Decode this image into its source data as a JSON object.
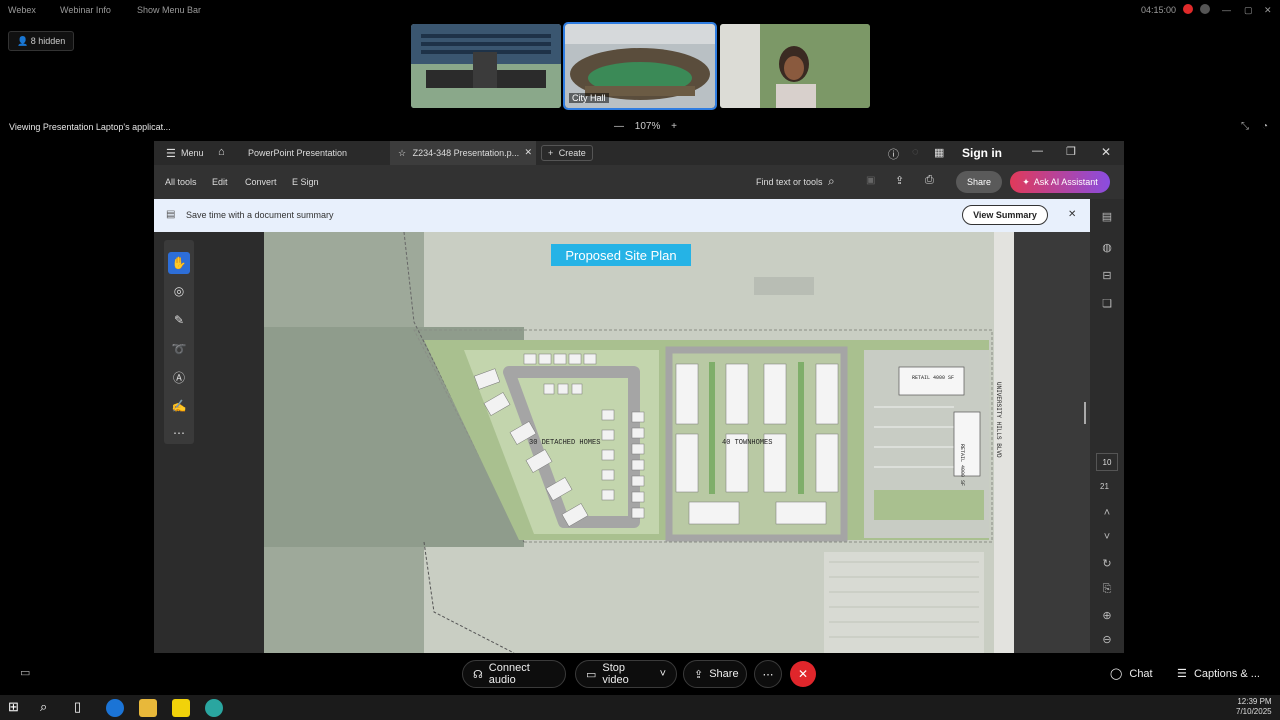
{
  "webex": {
    "app_name": "Webex",
    "webinar_info": "Webinar Info",
    "show_menu_bar": "Show Menu Bar",
    "clock": "04:15:00",
    "hidden_count": "8 hidden",
    "thumbnails": [
      {
        "label": ""
      },
      {
        "label": "City Hall"
      },
      {
        "label": ""
      }
    ],
    "viewing_text": "Viewing Presentation Laptop's applicat...",
    "zoom_level": "107%",
    "controls": {
      "connect_audio": "Connect audio",
      "stop_video": "Stop video",
      "share": "Share",
      "chat": "Chat",
      "captions": "Captions & ..."
    }
  },
  "acrobat": {
    "menu": "Menu",
    "tabs": [
      {
        "label": "PowerPoint Presentation"
      },
      {
        "label": "Z234-348 Presentation.p..."
      },
      {
        "label": "Create"
      }
    ],
    "sign_in": "Sign in",
    "toolbar": {
      "all_tools": "All tools",
      "edit": "Edit",
      "convert": "Convert",
      "esign": "E Sign",
      "find": "Find text or tools",
      "share": "Share",
      "ai": "Ask AI Assistant"
    },
    "banner": {
      "text": "Save time with a document summary",
      "button": "View Summary"
    },
    "page_numbers": {
      "current": "10",
      "total": "21"
    }
  },
  "slide": {
    "title": "Proposed Site Plan",
    "labels": {
      "detached": "30 DETACHED HOMES",
      "townhomes": "40 TOWNHOMES",
      "retail1": "RETAIL 4000 SF",
      "retail2": "RETAIL 4000 SF",
      "road": "UNIVERSITY HILLS BLVD"
    }
  },
  "taskbar": {
    "time": "12:39 PM",
    "date": "7/10/2025"
  }
}
